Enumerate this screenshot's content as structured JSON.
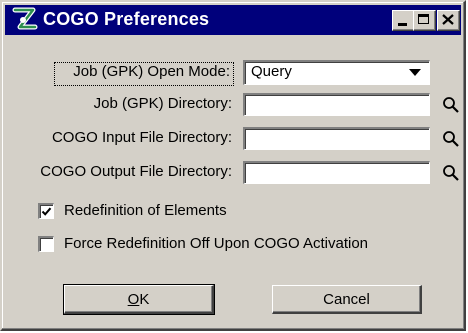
{
  "window": {
    "title": "COGO Preferences",
    "app_icon": "microstation-icon",
    "controls": [
      "minimize-icon",
      "maximize-icon",
      "close-icon"
    ]
  },
  "form": {
    "open_mode": {
      "label": "Job (GPK) Open Mode:",
      "value": "Query"
    },
    "job_dir": {
      "label": "Job (GPK) Directory:",
      "value": "",
      "icon": "search-icon"
    },
    "input_dir": {
      "label": "COGO Input File Directory:",
      "value": "",
      "icon": "search-icon"
    },
    "output_dir": {
      "label": "COGO Output File Directory:",
      "value": "",
      "icon": "search-icon"
    }
  },
  "options": {
    "redefinition": {
      "label": "Redefinition of Elements",
      "checked": true
    },
    "force_off": {
      "label": "Force Redefinition Off Upon COGO Activation",
      "checked": false
    }
  },
  "buttons": {
    "ok": "OK",
    "cancel": "Cancel"
  },
  "colors": {
    "titlebar": "#00007b",
    "face": "#d4d0c8",
    "icon_green": "#1f7a3a"
  }
}
